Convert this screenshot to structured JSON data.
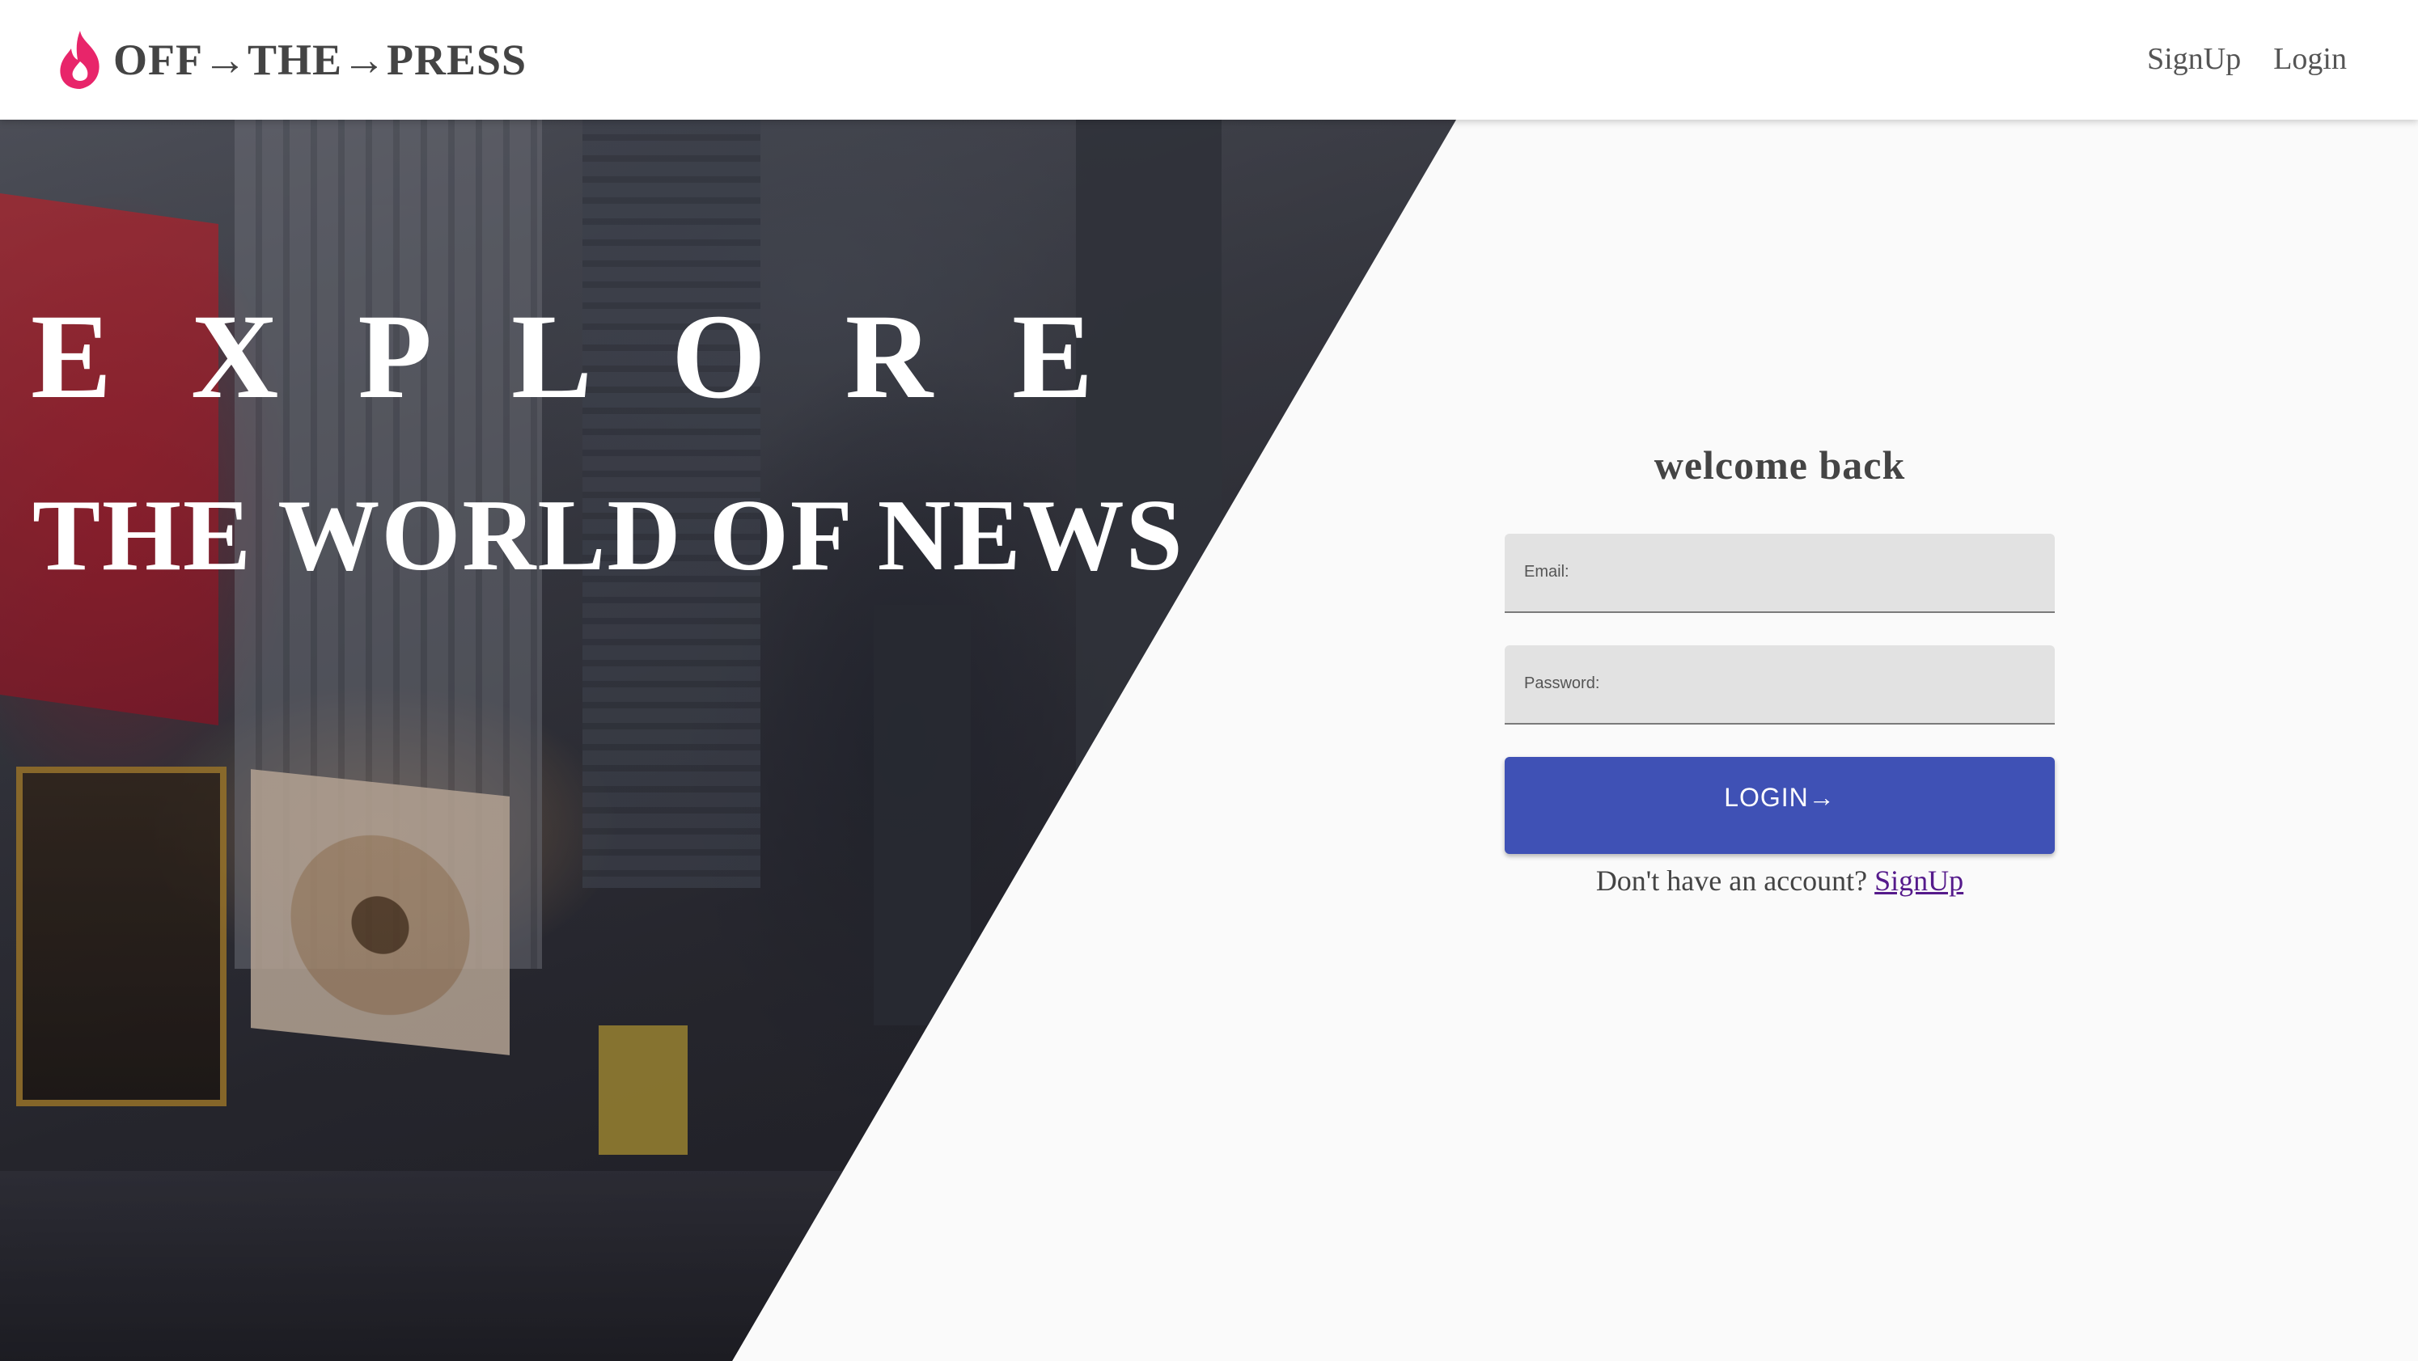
{
  "brand": {
    "name": "OFF→THE→PRESS",
    "icon": "flame-icon",
    "icon_color": "#e8256a"
  },
  "nav": {
    "signup_label": "SignUp",
    "login_label": "Login"
  },
  "hero": {
    "title": "EXPLORE",
    "subtitle": "THE WORLD OF NEWS"
  },
  "login": {
    "heading": "welcome back",
    "email_label": "Email:",
    "email_value": "",
    "password_label": "Password:",
    "password_value": "",
    "button_label": "LOGIN→",
    "prompt_text": "Don't have an account?",
    "prompt_link": "SignUp"
  },
  "colors": {
    "primary_button": "#3f51b5",
    "link_visited": "#551a8b",
    "page_background": "#fafafa",
    "input_background": "#e2e2e2"
  }
}
